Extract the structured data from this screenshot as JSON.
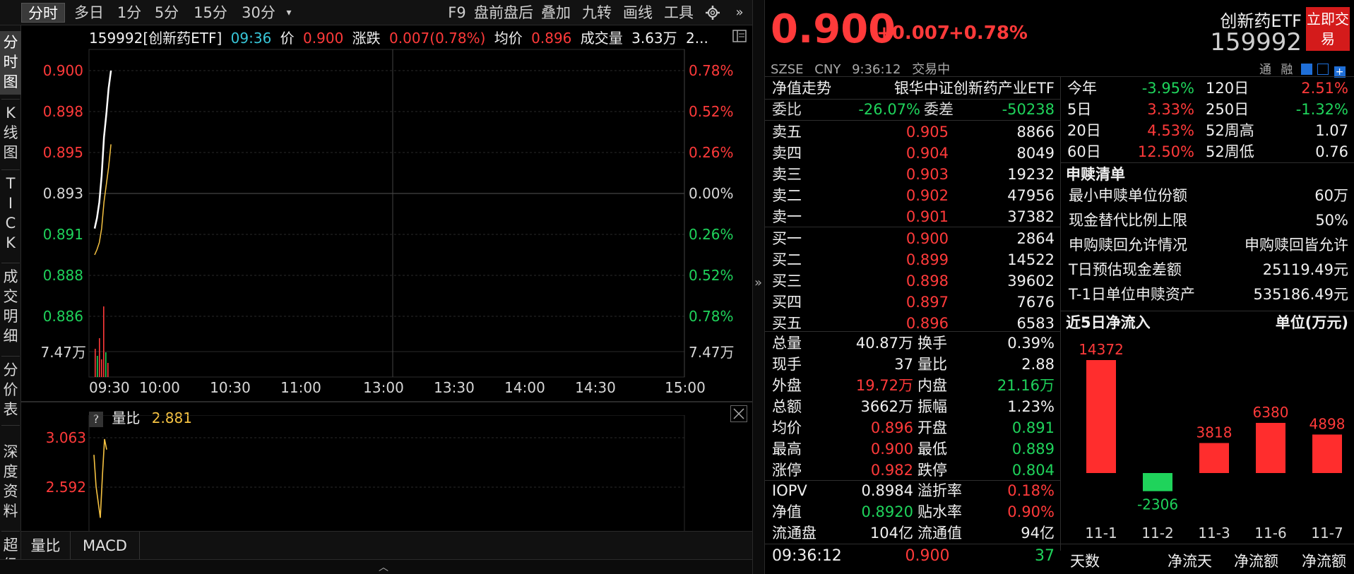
{
  "toolbar": {
    "tabs": [
      "分时",
      "多日",
      "1分",
      "5分",
      "15分",
      "30分"
    ],
    "right_tabs": [
      "F9",
      "盘前盘后",
      "叠加",
      "九转",
      "画线",
      "工具"
    ]
  },
  "sidebar": {
    "items": [
      "分时图",
      "K线图",
      "TICK",
      "成交明细",
      "分价表",
      "深度资料",
      "超级"
    ]
  },
  "info": {
    "code_name": "159992[创新药ETF]",
    "time": "09:36",
    "price_label": "价",
    "price": "0.900",
    "chg_label": "涨跌",
    "chg": "0.007(0.78%)",
    "avg_label": "均价",
    "avg": "0.896",
    "vol_label": "成交量",
    "vol": "3.63万",
    "more": "2..."
  },
  "chart_data": {
    "type": "line",
    "title": "",
    "x_ticks": [
      "09:30",
      "10:00",
      "10:30",
      "11:00",
      "13:00",
      "13:30",
      "14:00",
      "14:30",
      "15:00"
    ],
    "y_ticks_left": [
      "0.900",
      "0.898",
      "0.895",
      "0.893",
      "0.891",
      "0.888",
      "0.886"
    ],
    "y_ticks_right": [
      "0.78%",
      "0.52%",
      "0.26%",
      "0.00%",
      "0.26%",
      "0.52%",
      "0.78%"
    ],
    "y_range": [
      0.886,
      0.9
    ],
    "volume_label": "7.47万",
    "series": [
      {
        "name": "价",
        "values": [
          0.891,
          0.8916,
          0.8925,
          0.894,
          0.8962,
          0.8975,
          0.899,
          0.9
        ]
      },
      {
        "name": "均价",
        "values": [
          0.8895,
          0.8898,
          0.8902,
          0.891,
          0.8925,
          0.8935,
          0.8945,
          0.8958
        ]
      }
    ]
  },
  "sub_chart": {
    "help": "?",
    "name": "量比",
    "value": "2.881",
    "y_ticks": [
      "3.063",
      "2.592"
    ],
    "values": [
      2.9,
      2.6,
      2.45,
      2.3,
      2.7,
      3.05,
      2.95
    ]
  },
  "bottom_tabs": [
    "量比",
    "MACD"
  ],
  "quote": {
    "price": "0.900",
    "chg": "+0.007",
    "pct": "+0.78%",
    "name": "创新药ETF",
    "code": "159992",
    "trade_button": "立即交易",
    "exchange": "SZSE",
    "currency": "CNY",
    "time": "9:36:12",
    "status": "交易中",
    "badges": [
      "通",
      "融"
    ],
    "nav_label": "净值走势",
    "full_name": "银华中证创新药产业ETF",
    "weibi_label": "委比",
    "weibi": "-26.07%",
    "weicha_label": "委差",
    "weicha": "-50238",
    "asks": [
      {
        "label": "卖五",
        "price": "0.905",
        "vol": "8866"
      },
      {
        "label": "卖四",
        "price": "0.904",
        "vol": "8049"
      },
      {
        "label": "卖三",
        "price": "0.903",
        "vol": "19232"
      },
      {
        "label": "卖二",
        "price": "0.902",
        "vol": "47956"
      },
      {
        "label": "卖一",
        "price": "0.901",
        "vol": "37382"
      }
    ],
    "bids": [
      {
        "label": "买一",
        "price": "0.900",
        "vol": "2864"
      },
      {
        "label": "买二",
        "price": "0.899",
        "vol": "14522"
      },
      {
        "label": "买三",
        "price": "0.898",
        "vol": "39602"
      },
      {
        "label": "买四",
        "price": "0.897",
        "vol": "7676"
      },
      {
        "label": "买五",
        "price": "0.896",
        "vol": "6583"
      }
    ],
    "stats": [
      [
        {
          "k": "总量",
          "v": "40.87万",
          "c": "white"
        },
        {
          "k": "换手",
          "v": "0.39%",
          "c": "white"
        }
      ],
      [
        {
          "k": "现手",
          "v": "37",
          "c": "white"
        },
        {
          "k": "量比",
          "v": "2.88",
          "c": "white"
        }
      ],
      [
        {
          "k": "外盘",
          "v": "19.72万",
          "c": "red"
        },
        {
          "k": "内盘",
          "v": "21.16万",
          "c": "green"
        }
      ],
      [
        {
          "k": "总额",
          "v": "3662万",
          "c": "white"
        },
        {
          "k": "振幅",
          "v": "1.23%",
          "c": "white"
        }
      ],
      [
        {
          "k": "均价",
          "v": "0.896",
          "c": "red"
        },
        {
          "k": "开盘",
          "v": "0.891",
          "c": "green"
        }
      ],
      [
        {
          "k": "最高",
          "v": "0.900",
          "c": "red"
        },
        {
          "k": "最低",
          "v": "0.889",
          "c": "green"
        }
      ],
      [
        {
          "k": "涨停",
          "v": "0.982",
          "c": "red"
        },
        {
          "k": "跌停",
          "v": "0.804",
          "c": "green"
        }
      ]
    ],
    "stats2": [
      [
        {
          "k": "IOPV",
          "v": "0.8984",
          "c": "white"
        },
        {
          "k": "溢折率",
          "v": "0.18%",
          "c": "red"
        }
      ],
      [
        {
          "k": "净值",
          "v": "0.8920",
          "c": "green"
        },
        {
          "k": "贴水率",
          "v": "0.90%",
          "c": "red"
        }
      ],
      [
        {
          "k": "流通盘",
          "v": "104亿",
          "c": "white"
        },
        {
          "k": "流通值",
          "v": "94亿",
          "c": "white"
        }
      ]
    ],
    "last_trade": {
      "time": "09:36:12",
      "price": "0.900",
      "vol": "37"
    }
  },
  "perf": [
    [
      {
        "k": "今年",
        "v": "-3.95%",
        "c": "green"
      },
      {
        "k": "120日",
        "v": "2.51%",
        "c": "red"
      }
    ],
    [
      {
        "k": "5日",
        "v": "3.33%",
        "c": "red"
      },
      {
        "k": "250日",
        "v": "-1.32%",
        "c": "green"
      }
    ],
    [
      {
        "k": "20日",
        "v": "4.53%",
        "c": "red"
      },
      {
        "k": "52周高",
        "v": "1.07",
        "c": "white"
      }
    ],
    [
      {
        "k": "60日",
        "v": "12.50%",
        "c": "red"
      },
      {
        "k": "52周低",
        "v": "0.76",
        "c": "white"
      }
    ]
  ],
  "subscription": {
    "title": "申赎清单",
    "rows": [
      {
        "k": "最小申赎单位份额",
        "v": "60万"
      },
      {
        "k": "现金替代比例上限",
        "v": "50%"
      },
      {
        "k": "申购赎回允许情况",
        "v": "申购赎回皆允许"
      },
      {
        "k": "T日预估现金差额",
        "v": "25119.49元"
      },
      {
        "k": "T-1日单位申赎资产",
        "v": "535186.49元"
      }
    ]
  },
  "netflow": {
    "title": "近5日净流入",
    "unit": "单位(万元)",
    "dates": [
      "11-1",
      "11-2",
      "11-3",
      "11-6",
      "11-7"
    ],
    "values": [
      14372,
      -2306,
      3818,
      6380,
      4898
    ],
    "labels": [
      "14372",
      "-2306",
      "3818",
      "6380",
      "4898"
    ],
    "footer": [
      "天数",
      "净流天",
      "净流额",
      "净流额"
    ],
    "colors": {
      "pos": "#ff2d2d",
      "neg": "#1fd35b"
    }
  }
}
